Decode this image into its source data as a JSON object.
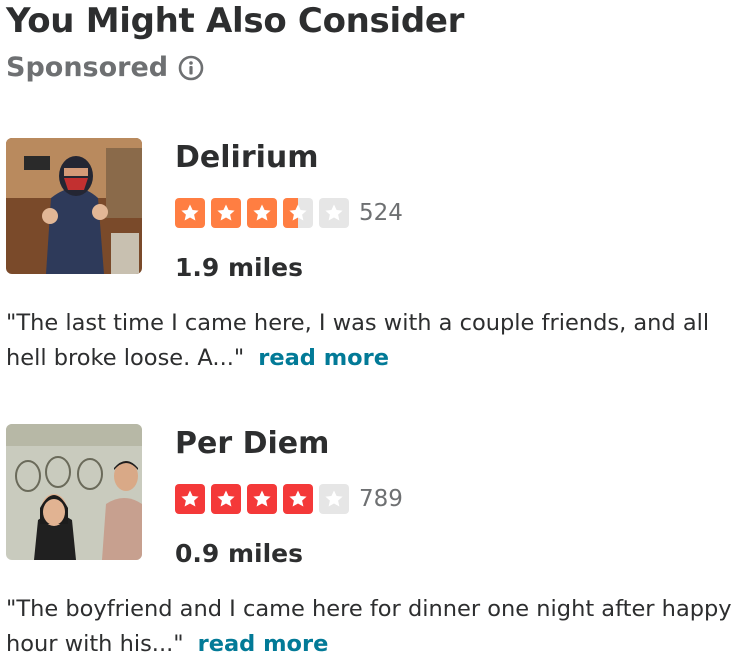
{
  "section": {
    "title": "You Might Also Consider",
    "sponsored_label": "Sponsored",
    "info_icon": "info-icon"
  },
  "businesses": [
    {
      "name": "Delirium",
      "rating": 3.5,
      "rating_color": "#ff7e42",
      "review_count": "524",
      "distance": "1.9 miles",
      "snippet": "\"The last time I came here, I was with a couple friends, and all hell broke loose. A...\"",
      "read_more": "read more"
    },
    {
      "name": "Per Diem",
      "rating": 4,
      "rating_color": "#f43939",
      "review_count": "789",
      "distance": "0.9 miles",
      "snippet": "\"The boyfriend and I came here for dinner one night after happy hour with his...\"",
      "read_more": "read more"
    }
  ],
  "colors": {
    "empty_star": "#e6e6e6",
    "link": "#027a97"
  }
}
